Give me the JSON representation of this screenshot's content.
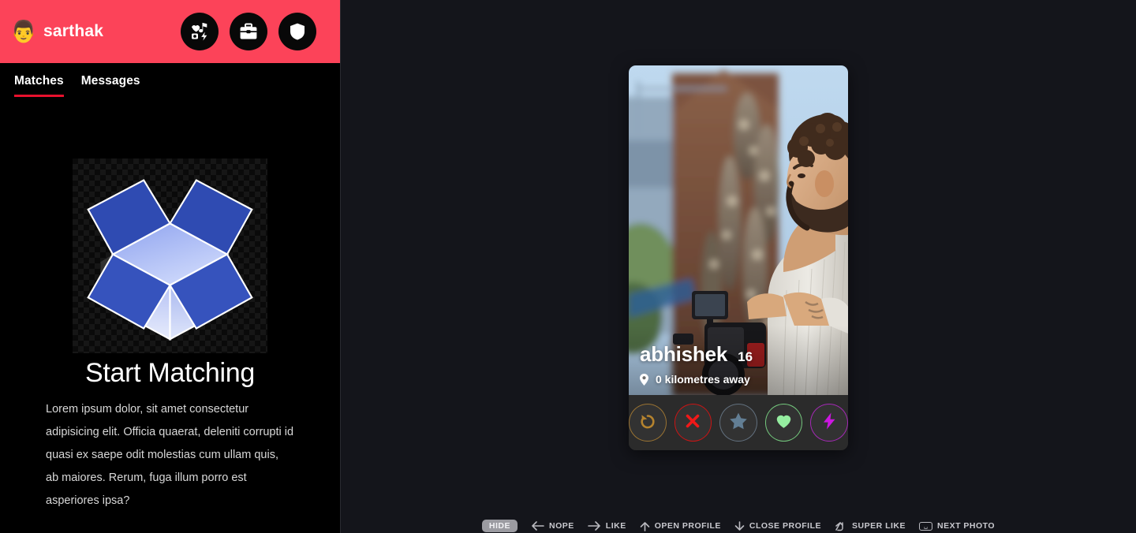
{
  "header": {
    "avatar_icon": "person-avatar-icon",
    "brand_name": "sarthak",
    "background_color": "#fc4359",
    "icons": [
      {
        "name": "apps-grid-icon",
        "label": "Apps"
      },
      {
        "name": "briefcase-icon",
        "label": "Work"
      },
      {
        "name": "shield-icon",
        "label": "Safety"
      }
    ]
  },
  "tabs": [
    {
      "label": "Matches",
      "active": true
    },
    {
      "label": "Messages",
      "active": false
    }
  ],
  "empty_state": {
    "image_icon": "open-box-illustration",
    "title": "Start Matching",
    "description": "Lorem ipsum dolor, sit amet consectetur adipisicing elit. Officia quaerat, deleniti corrupti id quasi ex saepe odit molestias cum ullam quis, ab maiores. Rerum, fuga illum porro est asperiores ipsa?"
  },
  "card": {
    "photo_alt": "man-with-camera-photo",
    "name": "abhishek",
    "age": "16",
    "location_icon": "map-pin-icon",
    "distance": "0 kilometres away",
    "actions": [
      {
        "name": "rewind-button",
        "icon": "rewind-icon",
        "color": "#9a7332",
        "glyph_color": "#b5832e"
      },
      {
        "name": "nope-button",
        "icon": "close-x-icon",
        "color": "#cc1414",
        "glyph_color": "#f01818"
      },
      {
        "name": "super-like-button",
        "icon": "star-icon",
        "color": "#62707e",
        "glyph_color": "#627e94"
      },
      {
        "name": "like-button",
        "icon": "heart-icon",
        "color": "#74c87d",
        "glyph_color": "#95eda0"
      },
      {
        "name": "boost-button",
        "icon": "lightning-icon",
        "color": "#a429b5",
        "glyph_color": "#cc17e0"
      }
    ]
  },
  "shortcuts": {
    "hide_label": "HIDE",
    "items": [
      {
        "key": "arrow-left",
        "label": "NOPE"
      },
      {
        "key": "arrow-right",
        "label": "LIKE"
      },
      {
        "key": "arrow-up",
        "label": "OPEN PROFILE"
      },
      {
        "key": "arrow-down",
        "label": "CLOSE PROFILE"
      },
      {
        "key": "shift-arrow-up",
        "label": "SUPER LIKE"
      },
      {
        "key": "space",
        "label": "NEXT PHOTO"
      }
    ]
  },
  "colors": {
    "brand": "#fc4359",
    "tab_underline": "#e8112d",
    "left_bg": "#000000",
    "right_bg": "#14151b",
    "card_actions_bg": "#2b2b2b"
  }
}
